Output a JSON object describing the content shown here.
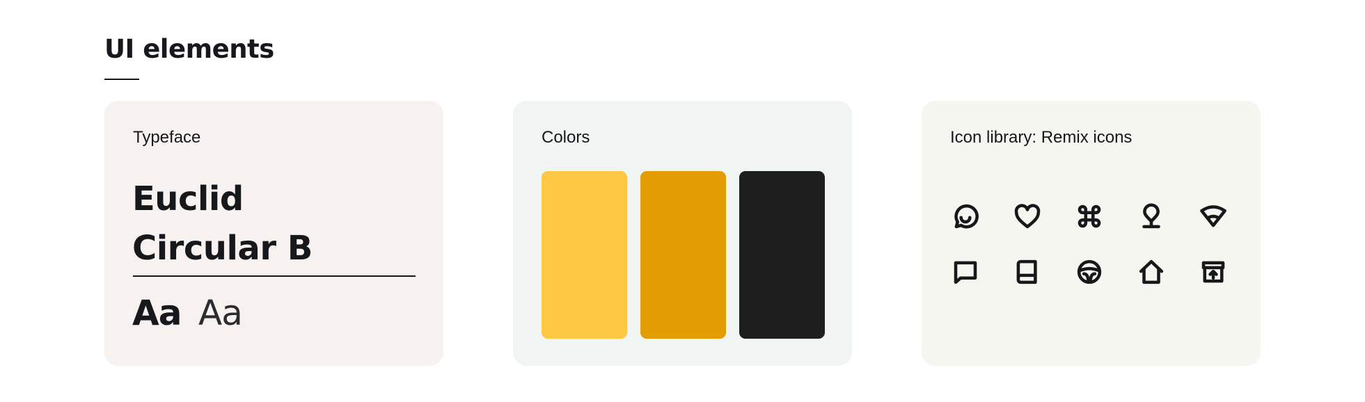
{
  "section": {
    "title": "UI elements"
  },
  "typeface_card": {
    "label": "Typeface",
    "name_line1": "Euclid",
    "name_line2": "Circular B",
    "sample_bold": "Aa",
    "sample_light": "Aa",
    "background": "#f7f1f0"
  },
  "colors_card": {
    "label": "Colors",
    "background": "#f0f5f4",
    "swatches": [
      "#fec844",
      "#e39d03",
      "#1e1e1e"
    ]
  },
  "icons_card": {
    "label": "Icon library: Remix icons",
    "background": "#f4f6ef",
    "icons": [
      "chat-smile-icon",
      "heart-icon",
      "command-icon",
      "map-pin-icon",
      "wifi-icon",
      "chat-square-icon",
      "book-icon",
      "steering-wheel-icon",
      "home-icon",
      "archive-upload-icon"
    ]
  }
}
